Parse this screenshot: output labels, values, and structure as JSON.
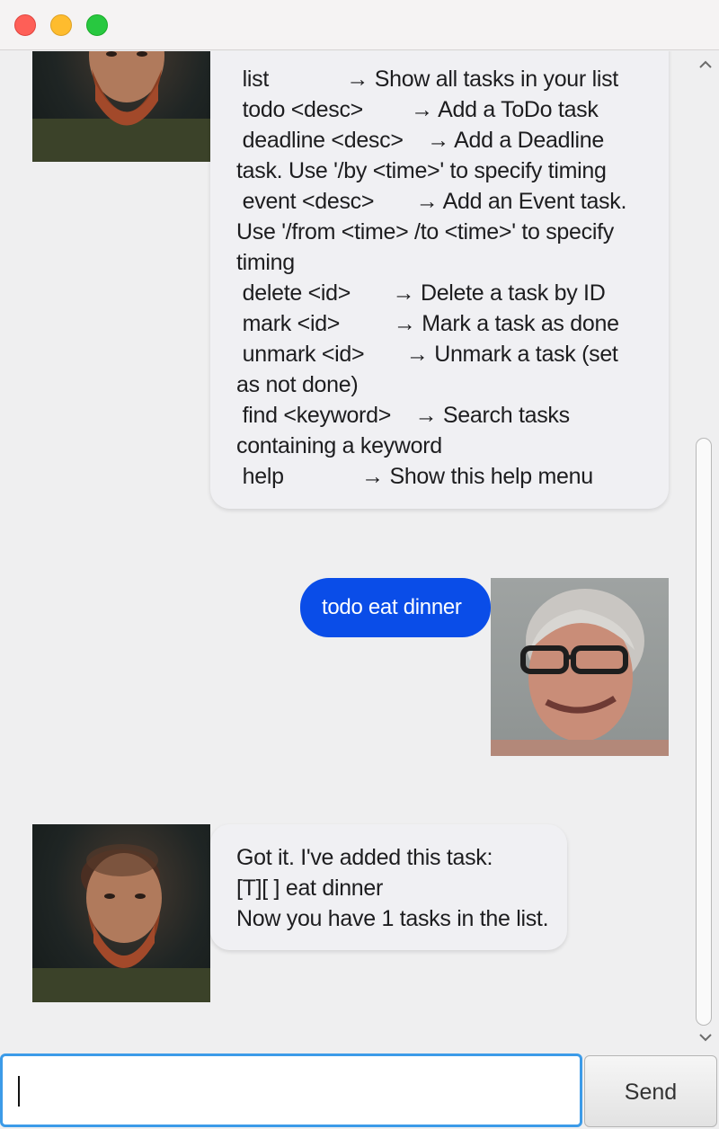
{
  "window": {
    "controls": [
      "close",
      "minimize",
      "maximize"
    ]
  },
  "chat": {
    "help_message": {
      "rows": [
        {
          "cmd": " list             ",
          "desc": "→ Show all tasks in your list"
        },
        {
          "cmd": " todo <desc>        ",
          "desc": "→ Add a ToDo task"
        },
        {
          "cmd": " deadline <desc>    ",
          "desc": "→ Add a Deadline task. Use '/by <time>' to specify timing"
        },
        {
          "cmd": " event <desc>       ",
          "desc": "→ Add an Event task. Use '/from <time> /to <time>' to specify timing"
        },
        {
          "cmd": " delete <id>       ",
          "desc": "→ Delete a task by ID"
        },
        {
          "cmd": " mark <id>         ",
          "desc": "→ Mark a task as done"
        },
        {
          "cmd": " unmark <id>       ",
          "desc": "→ Unmark a task (set as not done)"
        },
        {
          "cmd": " find <keyword>    ",
          "desc": "→ Search tasks containing a keyword"
        },
        {
          "cmd": " help             ",
          "desc": "→ Show this help menu"
        }
      ]
    },
    "user_message": "todo eat dinner",
    "bot_reply": [
      "Got it. I've added this task:",
      "[T][ ] eat dinner",
      "Now you have 1 tasks in the list."
    ]
  },
  "input": {
    "value": "",
    "send_label": "Send"
  },
  "colors": {
    "user_bubble": "#0a4de8",
    "bot_bubble": "#f0f0f3",
    "focus_ring": "#3c9be8"
  }
}
